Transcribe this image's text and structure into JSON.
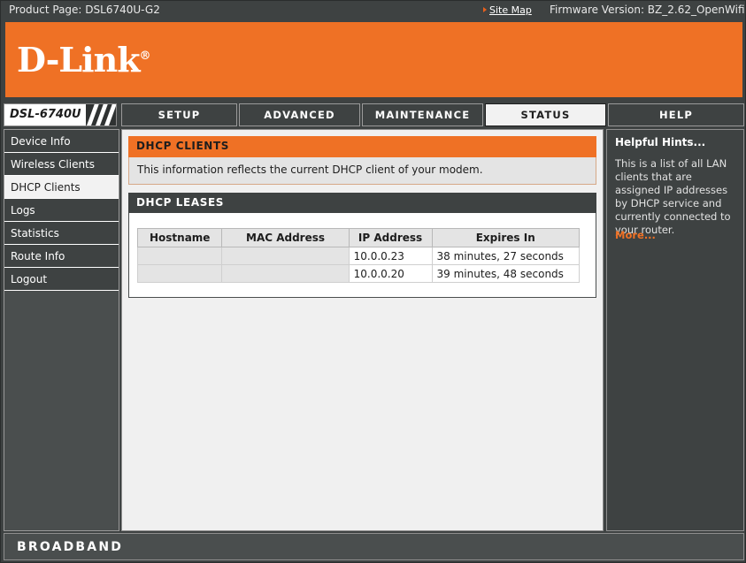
{
  "topbar": {
    "product_page": "Product Page: DSL6740U-G2",
    "site_map": "Site Map",
    "firmware": "Firmware Version: BZ_2.62_OpenWifi"
  },
  "banner": {
    "logo_text": "D-Link",
    "logo_reg": "®",
    "accent_color": "#ef7125"
  },
  "nav": {
    "model": "DSL-6740U",
    "tabs": [
      {
        "label": "SETUP",
        "active": false
      },
      {
        "label": "ADVANCED",
        "active": false
      },
      {
        "label": "MAINTENANCE",
        "active": false
      },
      {
        "label": "STATUS",
        "active": true
      },
      {
        "label": "HELP",
        "active": false
      }
    ]
  },
  "sidebar": {
    "items": [
      {
        "label": "Device Info",
        "active": false
      },
      {
        "label": "Wireless Clients",
        "active": false
      },
      {
        "label": "DHCP Clients",
        "active": true
      },
      {
        "label": "Logs",
        "active": false
      },
      {
        "label": "Statistics",
        "active": false
      },
      {
        "label": "Route Info",
        "active": false
      },
      {
        "label": "Logout",
        "active": false
      }
    ]
  },
  "main": {
    "section_title": "DHCP CLIENTS",
    "description": "This information reflects the current DHCP client of your modem.",
    "table_title": "DHCP LEASES",
    "table": {
      "columns": [
        "Hostname",
        "MAC Address",
        "IP Address",
        "Expires In"
      ],
      "rows": [
        {
          "hostname": "",
          "mac": "",
          "ip": "10.0.0.23",
          "expires": "38 minutes, 27 seconds"
        },
        {
          "hostname": "",
          "mac": "",
          "ip": "10.0.0.20",
          "expires": "39 minutes, 48 seconds"
        }
      ]
    }
  },
  "hints": {
    "title": "Helpful Hints...",
    "body": "This is a list of all LAN clients that are assigned IP addresses by DHCP service and currently connected to your router.",
    "more": "More...",
    "more_color": "#ef7125"
  },
  "footer": {
    "brand": "BROADBAND"
  }
}
